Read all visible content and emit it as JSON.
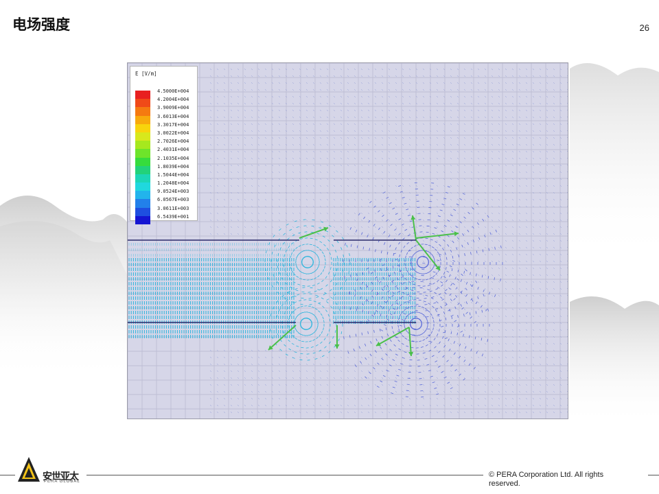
{
  "slide": {
    "title": "电场强度",
    "page_number": "26"
  },
  "legend": {
    "title": "E [V/m]",
    "entries": [
      {
        "value": "4.5000E+004",
        "color": "#e82020"
      },
      {
        "value": "4.2004E+004",
        "color": "#f04a18"
      },
      {
        "value": "3.9009E+004",
        "color": "#f57a10"
      },
      {
        "value": "3.6013E+004",
        "color": "#f8aa0c"
      },
      {
        "value": "3.3017E+004",
        "color": "#f8d40c"
      },
      {
        "value": "3.0022E+004",
        "color": "#d8e81c"
      },
      {
        "value": "2.7026E+004",
        "color": "#a6e81e"
      },
      {
        "value": "2.4031E+004",
        "color": "#6ee42a"
      },
      {
        "value": "2.1035E+004",
        "color": "#36dc3c"
      },
      {
        "value": "1.8039E+004",
        "color": "#22d27a"
      },
      {
        "value": "1.5044E+004",
        "color": "#1cd6b6"
      },
      {
        "value": "1.2048E+004",
        "color": "#20d8de"
      },
      {
        "value": "9.0524E+003",
        "color": "#22b4ec"
      },
      {
        "value": "6.0567E+003",
        "color": "#2280ea"
      },
      {
        "value": "3.0611E+003",
        "color": "#1e4ee0"
      },
      {
        "value": "6.5439E+001",
        "color": "#1414d2"
      }
    ]
  },
  "footer": {
    "logo_text_cn": "安世亚太",
    "logo_text_en": "PERA GLOBAL",
    "copyright": "©  PERA Corporation Ltd. All rights reserved."
  },
  "colors": {
    "sim_background": "#d6d6e8",
    "grid": "#b7b7cf",
    "arrow_field": "#2ab4dc",
    "arrow_weak": "#5a6ad8",
    "arrow_strong": "#4ac04a",
    "conductor_line": "#2a2a6a"
  }
}
